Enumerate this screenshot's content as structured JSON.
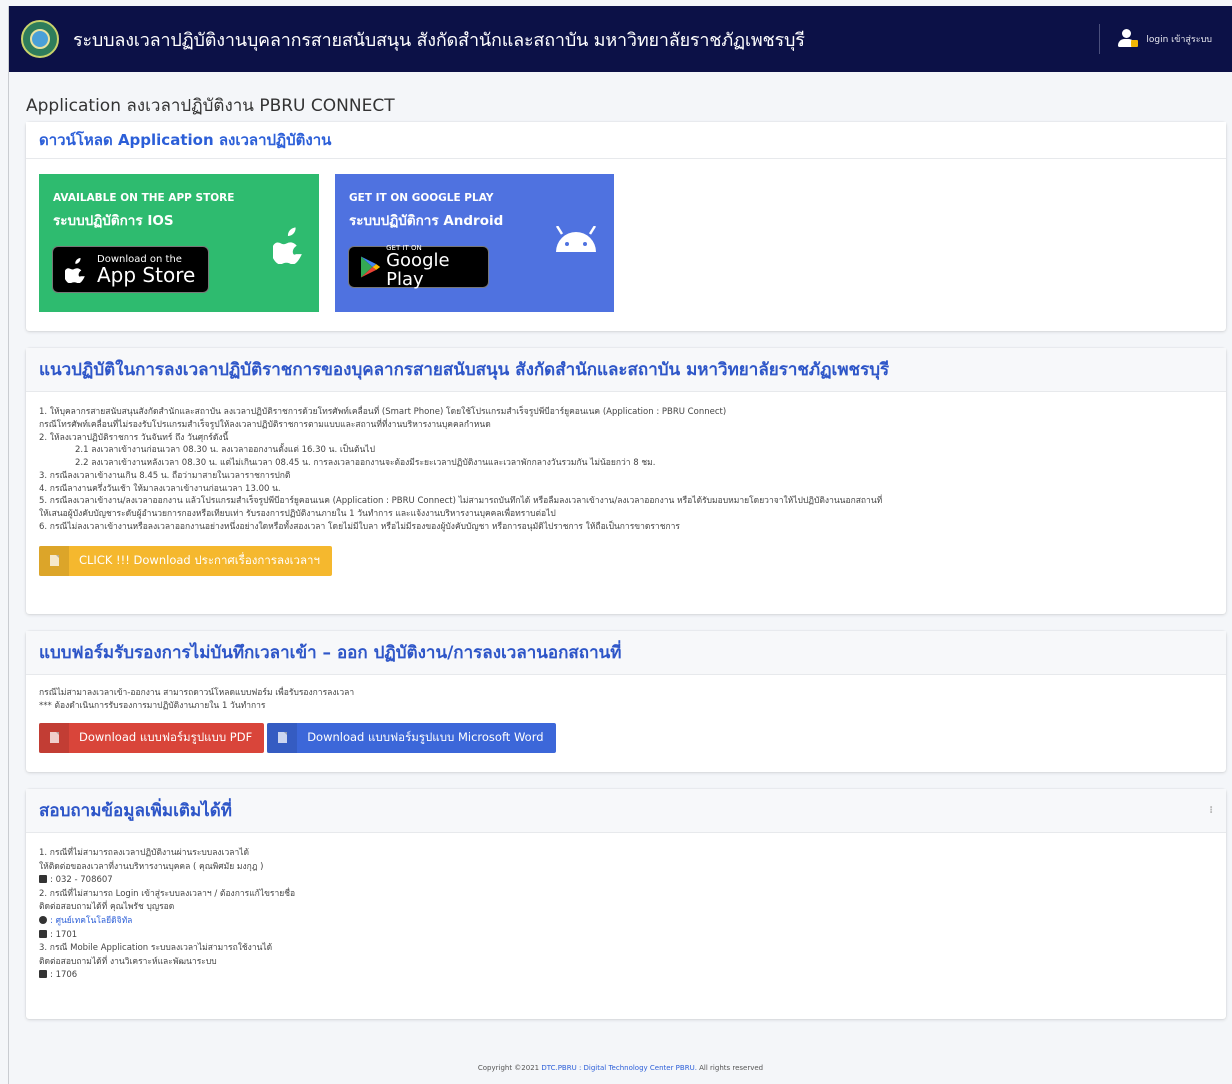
{
  "header": {
    "title": "ระบบลงเวลาปฏิบัติงานบุคลากรสายสนับสนุน สังกัดสำนักและสถาบัน มหาวิทยาลัยราชภัฏเพชรบุรี",
    "login_label": "login เข้าสู่ระบบ"
  },
  "page_title": "Application ลงเวลาปฏิบัติงาน PBRU CONNECT",
  "download_card": {
    "title": "ดาวน์โหลด Application ลงเวลาปฏิบัติงาน",
    "ios": {
      "small": "AVAILABLE ON THE APP STORE",
      "big": "ระบบปฏิบัติการ IOS",
      "badge_small": "Download on the",
      "badge_big": "App Store",
      "color": "#2ebb6f"
    },
    "android": {
      "small": "GET IT ON GOOGLE PLAY",
      "big": "ระบบปฏิบัติการ Android",
      "badge_small": "GET IT ON",
      "badge_big": "Google Play",
      "color": "#4f72e0"
    }
  },
  "guideline_card": {
    "title": "แนวปฏิบัติในการลงเวลาปฏิบัติราชการของบุคลากรสายสนับสนุน สังกัดสำนักและสถาบัน มหาวิทยาลัยราชภัฏเพชรบุรี",
    "lines": [
      "1. ให้บุคลากรสายสนับสนุนสังกัดสำนักและสถาบัน ลงเวลาปฏิบัติราชการด้วยโทรศัพท์เคลื่อนที่ (Smart Phone) โดยใช้โปรแกรมสำเร็จรูปพีบีอาร์ยูคอนเนค (Application : PBRU Connect)",
      "กรณีโทรศัพท์เคลื่อนที่ไม่รองรับโปรแกรมสำเร็จรูปให้ลงเวลาปฏิบัติราชการตามแบบและสถานที่ที่งานบริหารงานบุคคลกำหนด",
      "2. ให้ลงเวลาปฏิบัติราชการ วันจันทร์ ถึง วันศุกร์ดังนี้",
      "2.1 ลงเวลาเข้างานก่อนเวลา 08.30 น. ลงเวลาออกงานตั้งแต่ 16.30 น. เป็นต้นไป",
      "2.2 ลงเวลาเข้างานหลังเวลา 08.30 น. แต่ไม่เกินเวลา 08.45 น. การลงเวลาออกงานจะต้องมีระยะเวลาปฏิบัติงานและเวลาพักกลางวันรวมกัน ไม่น้อยกว่า 8 ชม.",
      "3. กรณีลงเวลาเข้างานเกิน 8.45 น. ถือว่ามาสายในเวลาราชการปกติ",
      "4. กรณีลางานครึ่งวันเช้า ให้มาลงเวลาเข้างานก่อนเวลา 13.00 น.",
      "5. กรณีลงเวลาเข้างาน/ลงเวลาออกงาน แล้วโปรแกรมสำเร็จรูปพีบีอาร์ยูคอนเนค (Application : PBRU Connect) ไม่สามารถบันทึกได้ หรือลืมลงเวลาเข้างาน/ลงเวลาออกงาน หรือได้รับมอบหมายโดยวาจาให้ไปปฏิบัติงานนอกสถานที่",
      "ให้เสนอผู้บังคับบัญชาระดับผู้อำนวยการกองหรือเทียบเท่า รับรองการปฏิบัติงานภายใน 1 วันทำการ และแจ้งงานบริหารงานบุคคลเพื่อทราบต่อไป",
      "6. กรณีไม่ลงเวลาเข้างานหรือลงเวลาออกงานอย่างหนึ่งอย่างใดหรือทั้งสองเวลา โดยไม่มีใบลา หรือไม่มีรองของผู้บังคับบัญชา หรือการอนุมัติไปราชการ ให้ถือเป็นการขาดราชการ"
    ],
    "button": "CLICK !!! Download ประกาศเรื่องการลงเวลาฯ"
  },
  "form_card": {
    "title": "แบบฟอร์มรับรองการไม่บันทึกเวลาเข้า – ออก ปฏิบัติงาน/การลงเวลานอกสถานที่",
    "line1": "กรณีไม่สามาลงเวลาเข้า-ออกงาน สามารถดาวน์โหลดแบบฟอร์ม เพื่อรับรองการลงเวลา",
    "line2": "*** ต้องดำเนินการรับรองการมาปฏิบัติงานภายใน 1 วันทำการ",
    "pdf_button": "Download แบบฟอร์มรูปแบบ PDF",
    "word_button": "Download แบบฟอร์มรูปแบบ Microsoft Word"
  },
  "contact_card": {
    "title": "สอบถามข้อมูลเพิ่มเติมได้ที่",
    "l1": "1. กรณีที่ไม่สามารถลงเวลาปฏิบัติงานผ่านระบบลงเวลาได้",
    "l2": "ให้ติดต่อขอลงเวลาที่งานบริหารงานบุคคล ( คุณพิศมัย มงกุฎ )",
    "l3": ": 032 - 708607",
    "l4": "2. กรณีที่ไม่สามารถ Login เข้าสู่ระบบลงเวลาฯ / ต้องการแก้ไขรายชื่อ",
    "l5": "ติดต่อสอบถามได้ที่ คุณไพรัช บุญรอด",
    "l6": ": ศูนย์เทคโนโลยีดิจิทัล",
    "l7": ": 1701",
    "l8": "3. กรณี Mobile Application ระบบลงเวลาไม่สามารถใช้งานได้",
    "l9": "ติดต่อสอบถามได้ที่ งานวิเคราะห์และพัฒนาระบบ",
    "l10": ": 1706"
  },
  "footer": {
    "prefix": "Copyright ©2021 ",
    "link": "DTC.PBRU : Digital Technology Center PBRU.",
    "suffix": " All rights reserved"
  }
}
